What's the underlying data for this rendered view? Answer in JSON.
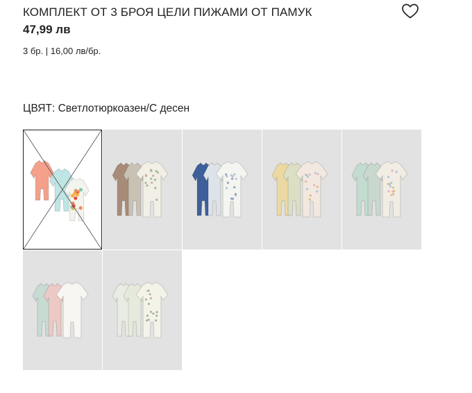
{
  "product": {
    "title": "КОМПЛЕКТ ОТ 3 БРОЯ ЦЕЛИ ПИЖАМИ ОТ ПАМУК",
    "price": "47,99 лв",
    "unit_price": "3 бр. | 16,00 лв/бр."
  },
  "favorite": {
    "icon": "heart-outline-icon"
  },
  "color": {
    "label": "ЦВЯТ:",
    "value": "Светлотюркоазен/С десен"
  },
  "swatches": [
    {
      "name": "Светлотюркоазен/С десен",
      "selected": true,
      "unavailable": true,
      "colors": [
        "#f4a08a",
        "#bfe5e4",
        "#f4f4ee"
      ],
      "pattern": "fruit"
    },
    {
      "name": "Бежов/С десен",
      "selected": false,
      "colors": [
        "#a88c78",
        "#c9c2b4",
        "#f2efe6"
      ],
      "pattern": "leaf"
    },
    {
      "name": "Син/С десен",
      "selected": false,
      "colors": [
        "#3d5f9a",
        "#dde3e8",
        "#f4f4f0"
      ],
      "pattern": "dots"
    },
    {
      "name": "Жълт/С десен",
      "selected": false,
      "colors": [
        "#ecd9a2",
        "#dcdfc4",
        "#f3e8e0"
      ],
      "pattern": "floral"
    },
    {
      "name": "Мента/С десен",
      "selected": false,
      "colors": [
        "#c3dcd0",
        "#c9d8cf",
        "#f2ede4"
      ],
      "pattern": "floral"
    },
    {
      "name": "Мента/Розов",
      "selected": false,
      "colors": [
        "#c7dbd3",
        "#ecc9c4",
        "#f7f6f2"
      ],
      "pattern": "plain"
    },
    {
      "name": "Бял/С десен",
      "selected": false,
      "colors": [
        "#e9ece2",
        "#e6eadd",
        "#f4f3ea"
      ],
      "pattern": "leaf"
    }
  ]
}
